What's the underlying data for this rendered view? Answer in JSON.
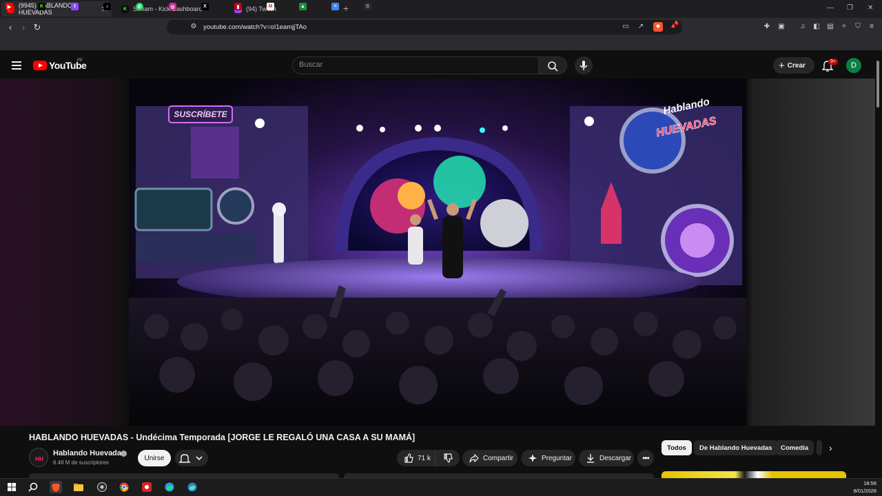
{
  "browser": {
    "tabs": [
      {
        "title": "(9945) HABLANDO HUEVADAS",
        "icon": "youtube-icon",
        "active": true
      },
      {
        "title": "Stream - Kick Dashboard",
        "icon": "kick-icon",
        "active": false
      },
      {
        "title": "(94) Twitch",
        "icon": "twitch-icon",
        "active": false
      }
    ],
    "url": "youtube.com/watch?v=oI1eamjjTAo",
    "bookmarks": [
      "youtube-icon",
      "kick-icon",
      "twitch-icon",
      "tiktok-icon",
      "whatsapp-icon",
      "instagram-icon",
      "x-icon",
      "red-app-icon",
      "gmail-icon",
      "drive-icon",
      "docs-icon",
      "s-app-icon"
    ],
    "shields_badge": "5"
  },
  "youtube": {
    "logo_text": "YouTube",
    "country": "PE",
    "search_placeholder": "Buscar",
    "create_label": "Crear",
    "notification_badge": "9+",
    "avatar_letter": "D"
  },
  "video": {
    "overlay_subscribe": "SUSCRÍBETE",
    "overlay_logo_top": "Hablando",
    "overlay_logo_bottom": "HUEVADAS"
  },
  "watch": {
    "title": "HABLANDO HUEVADAS - Undécima Temporada [JORGE LE REGALÓ UNA CASA A SU MAMÁ]",
    "channel_name": "Hablando Huevadas",
    "subscribers": "6.48 M de suscriptores",
    "join_label": "Unirse",
    "likes": "71 k",
    "share_label": "Compartir",
    "ask_label": "Preguntar",
    "download_label": "Descargar"
  },
  "chips": [
    "Todos",
    "De Hablando Huevadas",
    "Comedia"
  ],
  "taskbar": {
    "time": "18:56",
    "date": "8/01/2026"
  },
  "colors": {
    "youtube_red": "#ff0000",
    "avatar_green": "#0b8043",
    "badge_red": "#cc0000"
  }
}
